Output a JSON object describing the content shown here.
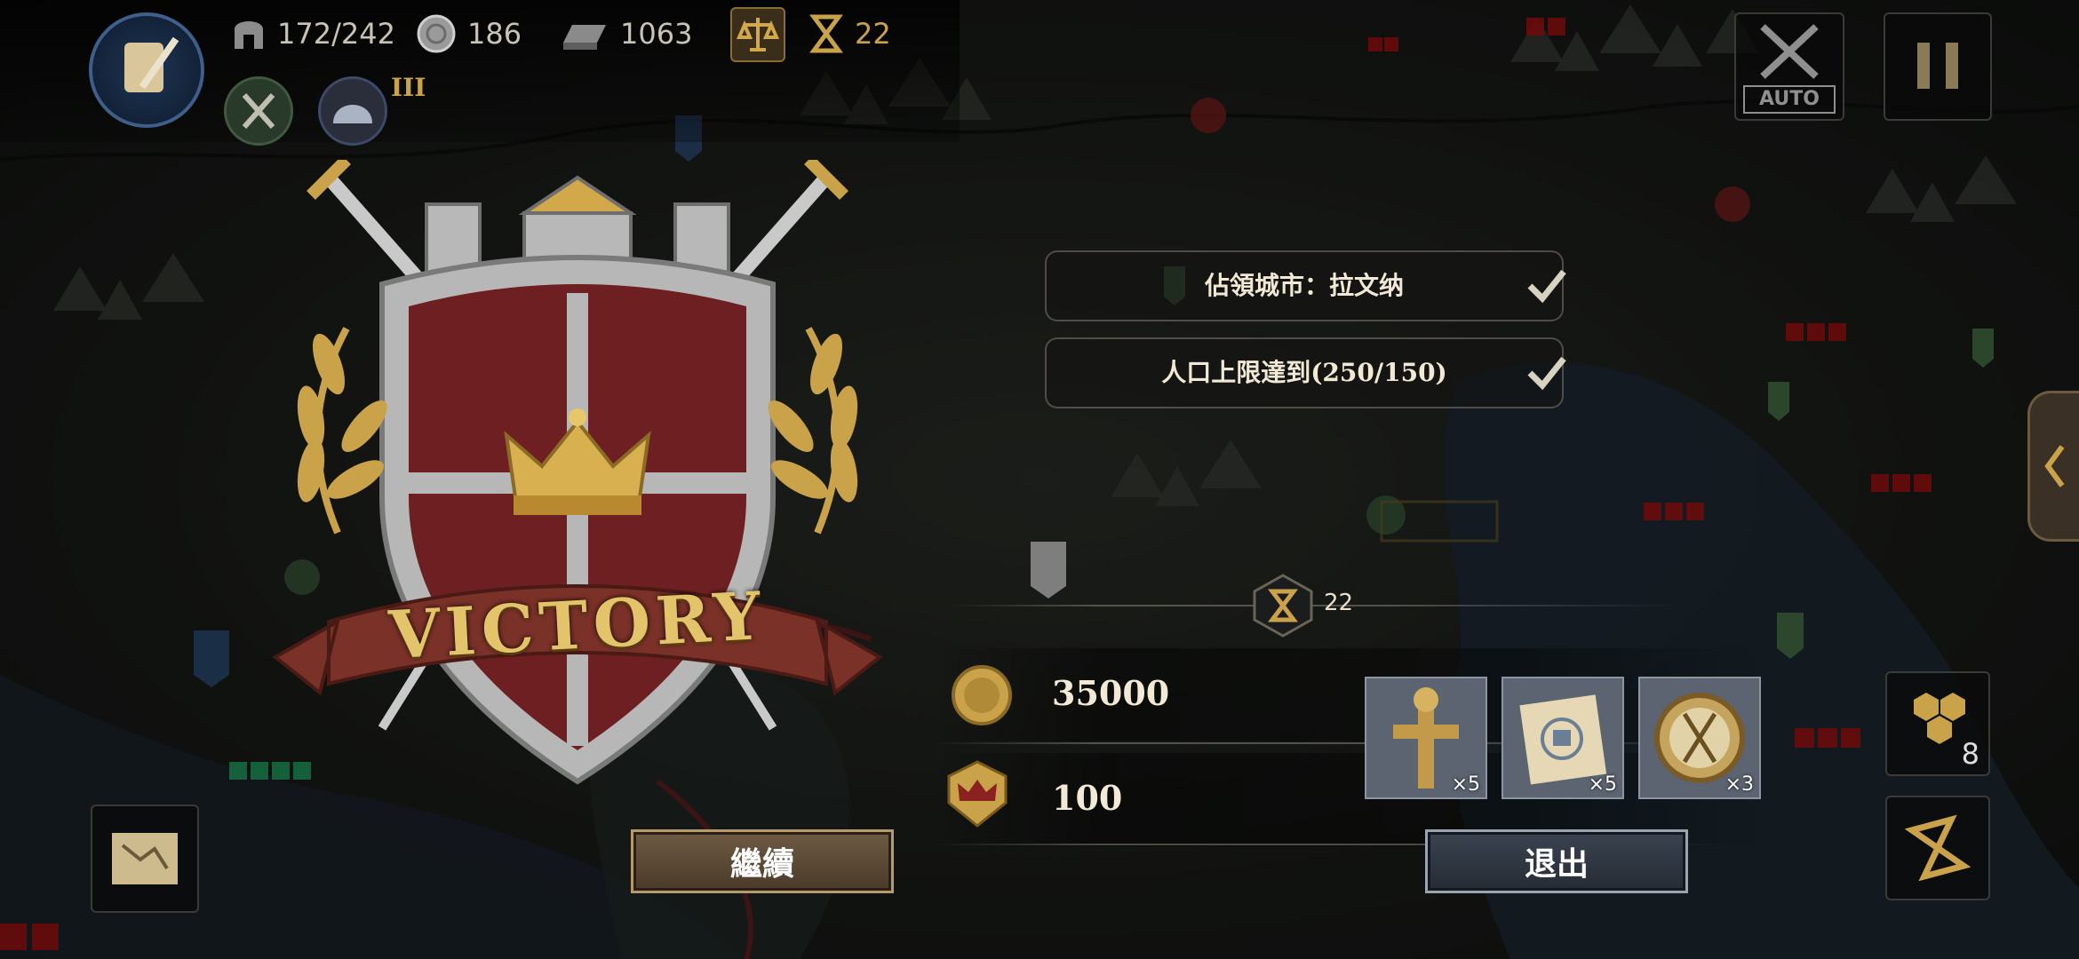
{
  "resources": {
    "troops": "172/242",
    "silver": "186",
    "iron": "1063",
    "turns": "22"
  },
  "level_roman": "III",
  "auto_label": "AUTO",
  "objectives": [
    {
      "text": "佔領城市：拉文纳",
      "done": true
    },
    {
      "text": "人口上限達到(250/150)",
      "done": true
    }
  ],
  "turn_counter": "22",
  "rewards": {
    "gold": "35000",
    "honor": "100",
    "items": [
      {
        "icon": "cannon-ramrod-icon",
        "count": "×5"
      },
      {
        "icon": "blueprint-scroll-icon",
        "count": "×5"
      },
      {
        "icon": "compass-icon",
        "count": "×3"
      }
    ]
  },
  "victory_text": "VICTORY",
  "buttons": {
    "continue": "繼續",
    "exit": "退出"
  },
  "side": {
    "hex_count": "8"
  },
  "colors": {
    "shield_red": "#6e1f22",
    "gold": "#c9a24a",
    "button_continue": "#5a4632",
    "button_exit": "#2e3540"
  }
}
